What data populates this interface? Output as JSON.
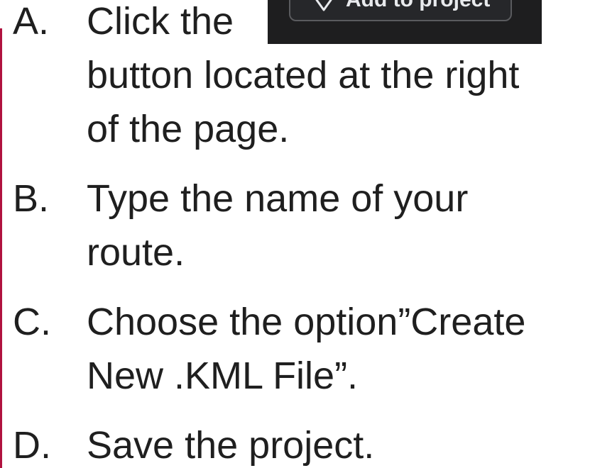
{
  "steps": [
    {
      "marker": "A.",
      "lines": [
        "Click the",
        "button located at the right",
        "of the page."
      ],
      "button": {
        "label": "Add to project",
        "icon": "map-pin-icon"
      }
    },
    {
      "marker": "B.",
      "lines": [
        "Type the name of your",
        "route."
      ]
    },
    {
      "marker": "C.",
      "lines": [
        "Choose the option”Create",
        "New .KML File”."
      ]
    },
    {
      "marker": "D.",
      "lines": [
        "Save the project."
      ]
    }
  ],
  "colors": {
    "text": "#1f1f1f",
    "accent_bar": "#b0123f",
    "button_background": "#1e1e1f",
    "button_text": "#e8eaed"
  }
}
